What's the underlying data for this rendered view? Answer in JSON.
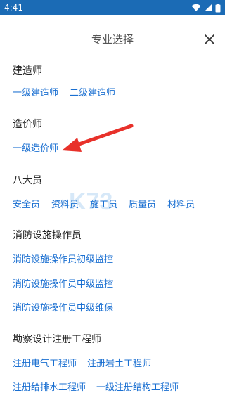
{
  "status_bar": {
    "time": "4:41",
    "background": "#1b6bb5"
  },
  "header": {
    "title": "专业选择",
    "close_icon": "close-icon"
  },
  "sections": [
    {
      "title": "建造师",
      "rows": [
        [
          "一级建造师",
          "二级建造师"
        ]
      ]
    },
    {
      "title": "造价师",
      "rows": [
        [
          "一级造价师"
        ]
      ]
    },
    {
      "title": "八大员",
      "rows": [
        [
          "安全员",
          "资料员",
          "施工员",
          "质量员",
          "材料员"
        ]
      ]
    },
    {
      "title": "消防设施操作员",
      "rows": [
        [
          "消防设施操作员初级监控"
        ],
        [
          "消防设施操作员中级监控"
        ],
        [
          "消防设施操作员中级维保"
        ]
      ]
    },
    {
      "title": "勘察设计注册工程师",
      "rows": [
        [
          "注册电气工程师",
          "注册岩土工程师"
        ],
        [
          "注册给排水工程师",
          "一级注册结构工程师"
        ]
      ]
    }
  ],
  "annotation": {
    "icon": "red-arrow-icon",
    "color": "#e8312a"
  },
  "watermark": {
    "text": "K73",
    "subtitle": "游戏之家"
  },
  "colors": {
    "link": "#1a6fd1",
    "section_title": "#222222",
    "header_title": "#555555"
  }
}
